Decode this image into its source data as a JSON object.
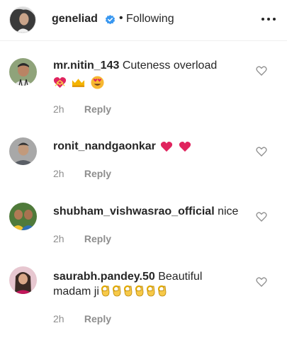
{
  "header": {
    "username": "geneliad",
    "separator": "•",
    "follow_status": "Following",
    "verified_icon": "verified-badge-icon",
    "more_icon": "more-options-icon",
    "accent": "#3897f0"
  },
  "comments": [
    {
      "username": "mr.nitin_143",
      "text": "Cuteness overload",
      "emojis": [
        "heart-with-ribbon",
        "crown",
        "heart-eyes-face"
      ],
      "time": "2h",
      "reply": "Reply"
    },
    {
      "username": "ronit_nandgaonkar",
      "text": "",
      "emojis": [
        "red-heart",
        "red-heart"
      ],
      "time": "2h",
      "reply": "Reply"
    },
    {
      "username": "shubham_vishwasrao_official",
      "text": "nice",
      "time": "2h",
      "reply": "Reply"
    },
    {
      "username": "saurabh.pandey.50",
      "text": "Beautiful",
      "text2": "madam ji",
      "emojis": [
        "ok-hand",
        "ok-hand",
        "ok-hand",
        "ok-hand",
        "ok-hand",
        "ok-hand"
      ],
      "time": "2h",
      "reply": "Reply"
    }
  ]
}
